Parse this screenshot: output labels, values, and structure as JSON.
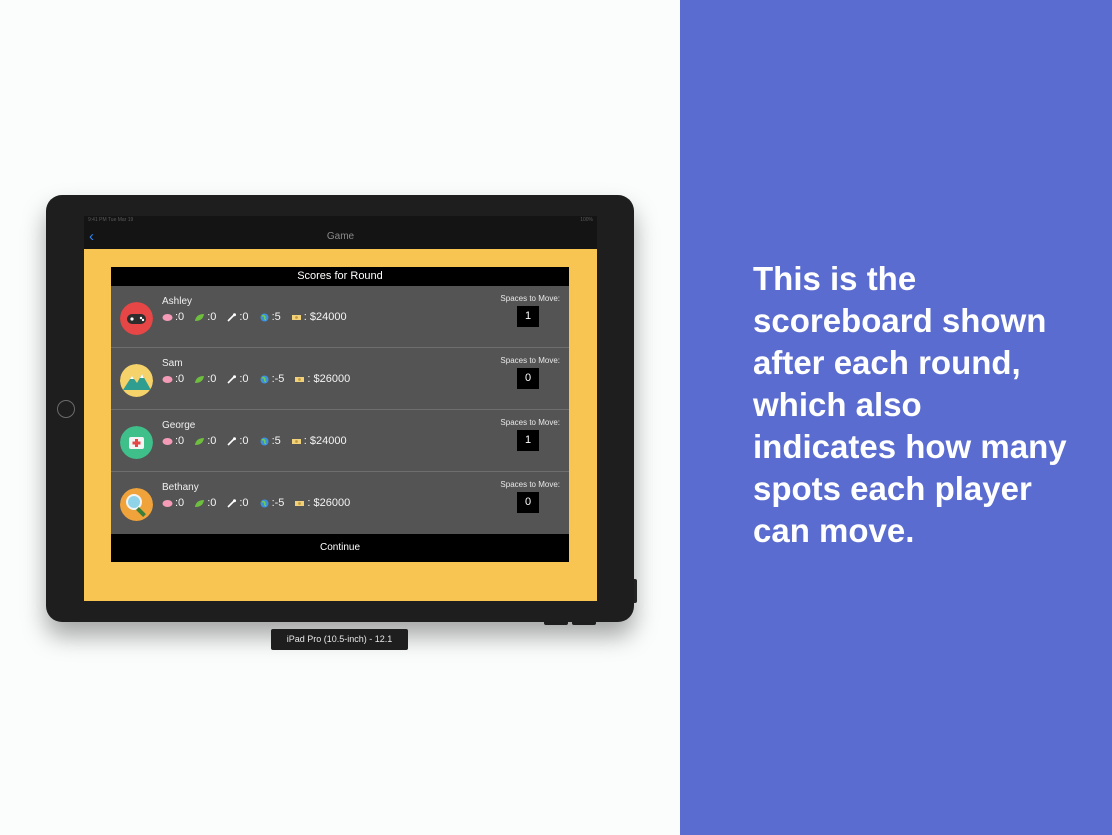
{
  "caption": "This is the scoreboard shown after each round, which also indicates how many spots each player can move.",
  "device": {
    "label": "iPad Pro (10.5-inch) - 12.1",
    "status_left": "9:41 PM  Tue Mar 19",
    "status_right": "100%"
  },
  "app": {
    "nav_title": "Game",
    "back_icon": "chevron-left-icon",
    "dialog_title": "Scores for Round",
    "continue_label": "Continue",
    "spaces_label": "Spaces to Move:",
    "stat_icons": [
      "brain-icon",
      "leaf-icon",
      "tool-icon",
      "globe-icon",
      "money-icon"
    ]
  },
  "players": [
    {
      "name": "Ashley",
      "avatar": "gamepad-avatar-icon",
      "stats": [
        ":0",
        ":0",
        ":0",
        ":5",
        ": $24000"
      ],
      "spaces": "1"
    },
    {
      "name": "Sam",
      "avatar": "mountain-avatar-icon",
      "stats": [
        ":0",
        ":0",
        ":0",
        ":-5",
        ": $26000"
      ],
      "spaces": "0"
    },
    {
      "name": "George",
      "avatar": "medkit-avatar-icon",
      "stats": [
        ":0",
        ":0",
        ":0",
        ":5",
        ": $24000"
      ],
      "spaces": "1"
    },
    {
      "name": "Bethany",
      "avatar": "magnifier-avatar-icon",
      "stats": [
        ":0",
        ":0",
        ":0",
        ":-5",
        ": $26000"
      ],
      "spaces": "0"
    }
  ],
  "colors": {
    "panel": "#5a6ccf",
    "app_background": "#f8c553",
    "dialog": "#545454"
  }
}
